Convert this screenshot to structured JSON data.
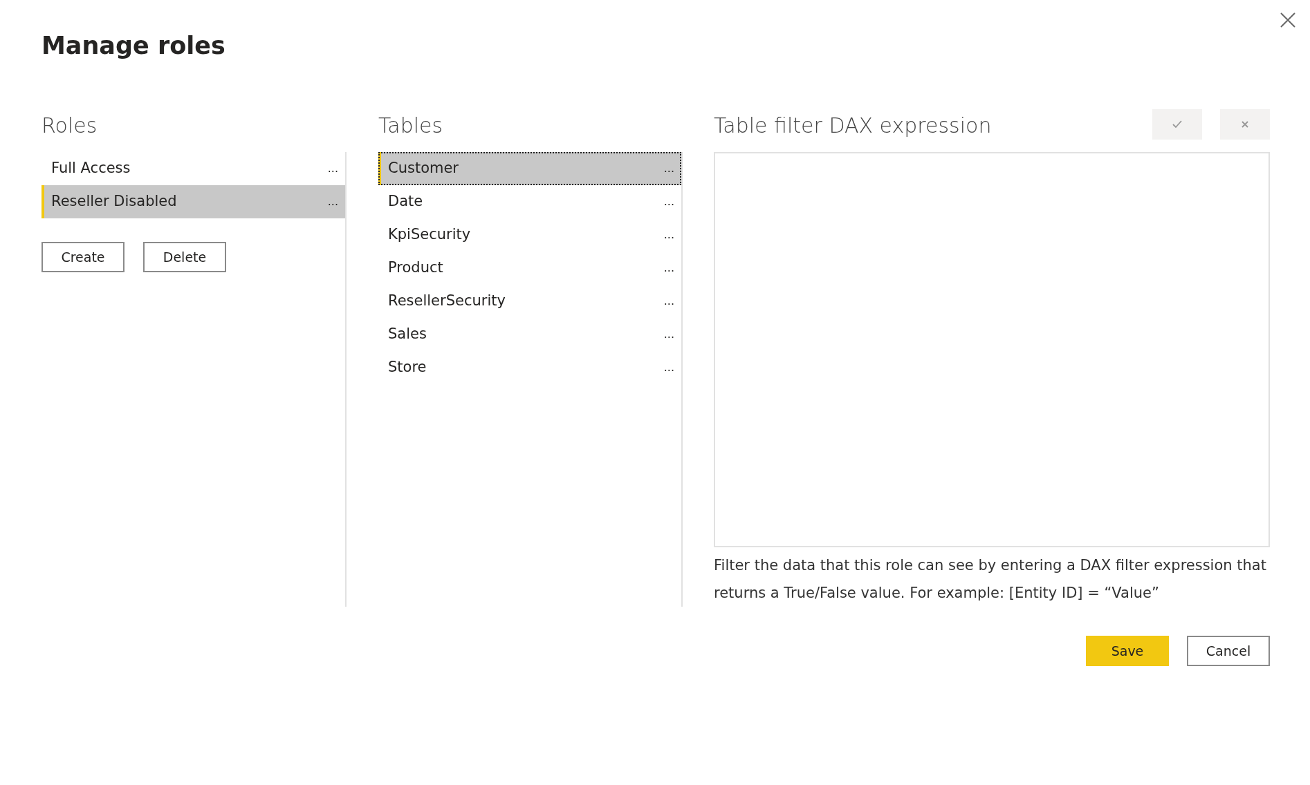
{
  "dialog": {
    "title": "Manage roles"
  },
  "roles": {
    "heading": "Roles",
    "items": [
      {
        "label": "Full Access",
        "menu": "...",
        "selected": false
      },
      {
        "label": "Reseller Disabled",
        "menu": "...",
        "selected": true
      }
    ],
    "buttons": [
      "Create",
      "Delete"
    ]
  },
  "tables": {
    "heading": "Tables",
    "items": [
      {
        "label": "Customer",
        "menu": "...",
        "selected": true,
        "focused": true
      },
      {
        "label": "Date",
        "menu": "...",
        "selected": false,
        "focused": false
      },
      {
        "label": "KpiSecurity",
        "menu": "...",
        "selected": false,
        "focused": false
      },
      {
        "label": "Product",
        "menu": "...",
        "selected": false,
        "focused": false
      },
      {
        "label": "ResellerSecurity",
        "menu": "...",
        "selected": false,
        "focused": false
      },
      {
        "label": "Sales",
        "menu": "...",
        "selected": false,
        "focused": false
      },
      {
        "label": "Store",
        "menu": "...",
        "selected": false,
        "focused": false
      }
    ]
  },
  "filter": {
    "heading": "Table filter DAX expression",
    "help": "Filter the data that this role can see by entering a DAX filter expression that returns a True/False value. For example: [Entity ID] = “Value”"
  },
  "footer": {
    "buttons": [
      {
        "label": "Save",
        "kind": "primary"
      },
      {
        "label": "Cancel",
        "kind": "secondary"
      }
    ]
  }
}
